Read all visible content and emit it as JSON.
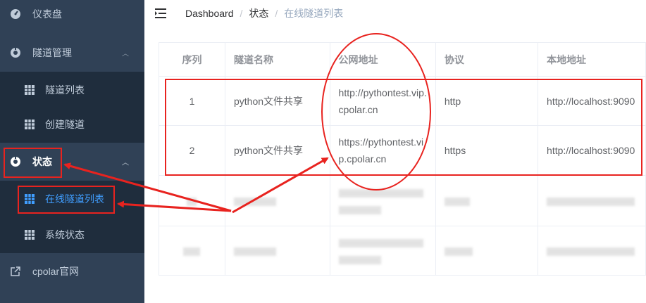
{
  "sidebar": {
    "items": [
      {
        "label": "仪表盘",
        "icon": "dashboard-icon"
      },
      {
        "label": "隧道管理",
        "icon": "tunnel-manage-icon"
      },
      {
        "label": "隧道列表",
        "icon": "grid-icon"
      },
      {
        "label": "创建隧道",
        "icon": "grid-icon"
      },
      {
        "label": "状态",
        "icon": "status-icon"
      },
      {
        "label": "在线隧道列表",
        "icon": "grid-icon"
      },
      {
        "label": "系统状态",
        "icon": "grid-icon"
      },
      {
        "label": "cpolar官网",
        "icon": "external-link-icon"
      }
    ]
  },
  "header": {
    "breadcrumb": [
      "Dashboard",
      "状态",
      "在线隧道列表"
    ],
    "separator": "/"
  },
  "table": {
    "columns": [
      "序列",
      "隧道名称",
      "公网地址",
      "协议",
      "本地地址"
    ],
    "rows": [
      {
        "index": "1",
        "name": "python文件共享",
        "url_line1": "http://pythontest.vip.",
        "url_line2": "cpolar.cn",
        "protocol": "http",
        "local": "http://localhost:9090"
      },
      {
        "index": "2",
        "name": "python文件共享",
        "url_line1": "https://pythontest.vi",
        "url_line2": "p.cpolar.cn",
        "protocol": "https",
        "local": "http://localhost:9090"
      }
    ]
  },
  "colors": {
    "sidebar_bg": "#304156",
    "submenu_bg": "#1f2d3d",
    "active": "#409eff",
    "annotation": "#e8231f"
  }
}
